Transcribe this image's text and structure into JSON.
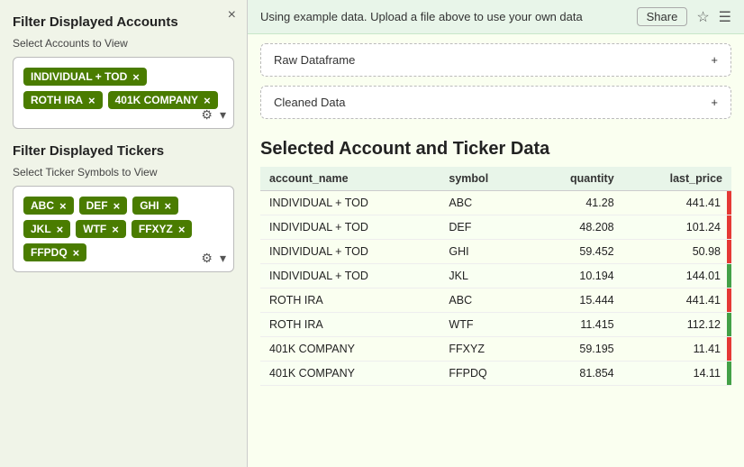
{
  "sidebar": {
    "close_label": "×",
    "accounts_section_title": "Filter Displayed Accounts",
    "accounts_sub_label": "Select Accounts to View",
    "accounts_tags": [
      {
        "label": "INDIVIDUAL + TOD",
        "id": "ind-tod"
      },
      {
        "label": "ROTH IRA",
        "id": "roth-ira"
      },
      {
        "label": "401K COMPANY",
        "id": "401k"
      }
    ],
    "tickers_section_title": "Filter Displayed Tickers",
    "tickers_sub_label": "Select Ticker Symbols to View",
    "tickers_tags": [
      {
        "label": "ABC",
        "id": "abc"
      },
      {
        "label": "DEF",
        "id": "def"
      },
      {
        "label": "GHI",
        "id": "ghi"
      },
      {
        "label": "JKL",
        "id": "jkl"
      },
      {
        "label": "WTF",
        "id": "wtf"
      },
      {
        "label": "FFXYZ",
        "id": "ffxyz"
      },
      {
        "label": "FFPDQ",
        "id": "ffpdq"
      }
    ]
  },
  "main": {
    "banner_text": "Using example data. Upload a file above to use your own data",
    "share_label": "Share",
    "raw_dataframe_label": "Raw Dataframe",
    "cleaned_data_label": "Cleaned Data",
    "section_heading": "Selected Account and Ticker Data",
    "table": {
      "columns": [
        "account_name",
        "symbol",
        "quantity",
        "last_price"
      ],
      "rows": [
        {
          "account_name": "INDIVIDUAL + TOD",
          "symbol": "ABC",
          "quantity": "41.28",
          "last_price": "441.41",
          "indicator": "red"
        },
        {
          "account_name": "INDIVIDUAL + TOD",
          "symbol": "DEF",
          "quantity": "48.208",
          "last_price": "101.24",
          "indicator": "red"
        },
        {
          "account_name": "INDIVIDUAL + TOD",
          "symbol": "GHI",
          "quantity": "59.452",
          "last_price": "50.98",
          "indicator": "red"
        },
        {
          "account_name": "INDIVIDUAL + TOD",
          "symbol": "JKL",
          "quantity": "10.194",
          "last_price": "144.01",
          "indicator": "green"
        },
        {
          "account_name": "ROTH IRA",
          "symbol": "ABC",
          "quantity": "15.444",
          "last_price": "441.41",
          "indicator": "red"
        },
        {
          "account_name": "ROTH IRA",
          "symbol": "WTF",
          "quantity": "11.415",
          "last_price": "112.12",
          "indicator": "green"
        },
        {
          "account_name": "401K COMPANY",
          "symbol": "FFXYZ",
          "quantity": "59.195",
          "last_price": "11.41",
          "indicator": "red"
        },
        {
          "account_name": "401K COMPANY",
          "symbol": "FFPDQ",
          "quantity": "81.854",
          "last_price": "14.11",
          "indicator": "green"
        }
      ]
    }
  }
}
